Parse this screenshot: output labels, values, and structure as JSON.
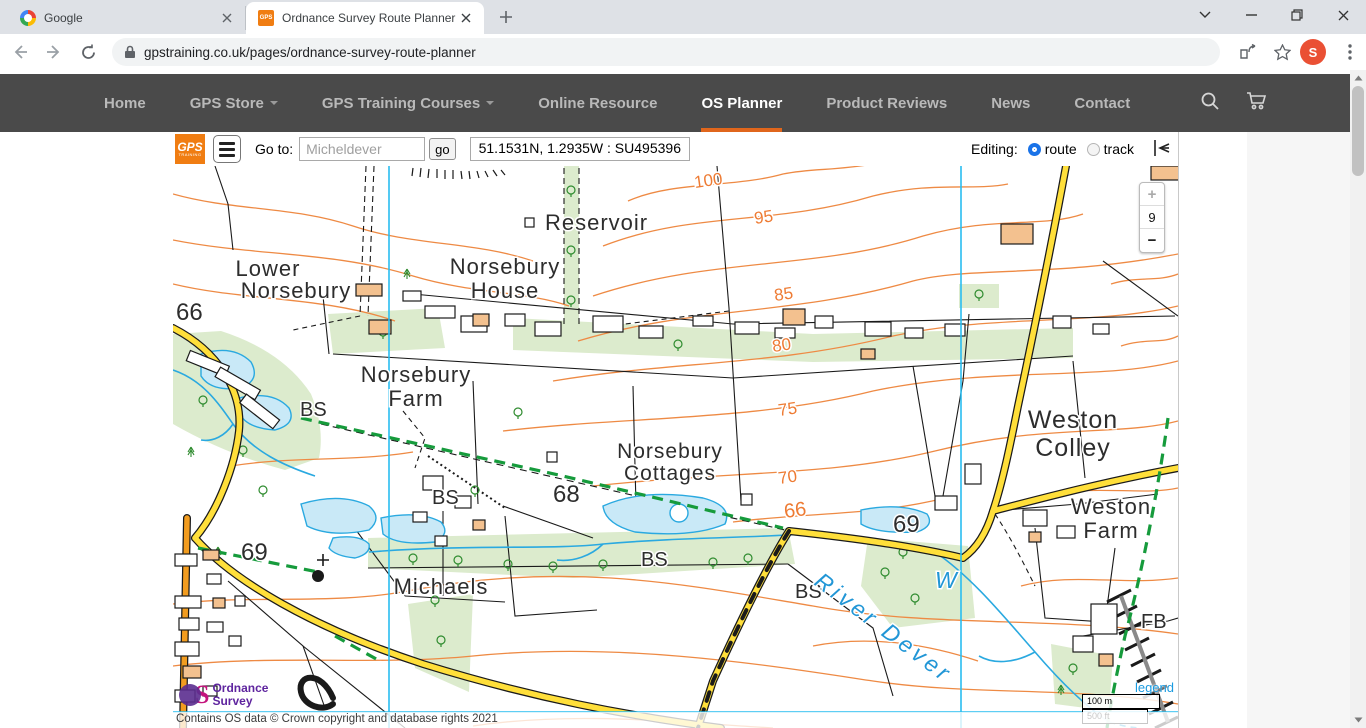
{
  "browser": {
    "tabs": [
      {
        "title": "Google"
      },
      {
        "title": "Ordnance Survey Route Planner –"
      }
    ],
    "favicon_gps": "GPS",
    "url": "gpstraining.co.uk/pages/ordnance-survey-route-planner",
    "avatar": "S"
  },
  "nav": {
    "items": [
      {
        "label": "Home"
      },
      {
        "label": "GPS Store"
      },
      {
        "label": "GPS Training Courses"
      },
      {
        "label": "Online Resource"
      },
      {
        "label": "OS Planner"
      },
      {
        "label": "Product Reviews"
      },
      {
        "label": "News"
      },
      {
        "label": "Contact"
      }
    ],
    "active": "OS Planner"
  },
  "toolbar": {
    "logo_line1": "GPS",
    "logo_line2": "TRAINING",
    "goto_label": "Go to:",
    "search_placeholder": "Micheldever",
    "go_label": "go",
    "coordinates": "51.1531N, 1.2935W : SU495396",
    "editing_label": "Editing:",
    "route_label": "route",
    "track_label": "track"
  },
  "map": {
    "zoom_in": "+",
    "zoom_level": "9",
    "zoom_out": "−",
    "legend_label": "legend",
    "scale_metric": "100 m",
    "scale_imperial": "500 ft",
    "attribution": "Contains OS data © Crown copyright and database rights 2021",
    "os_logo_1": "Ordnance",
    "os_logo_2": "Survey",
    "labels": {
      "reservoir": "Reservoir",
      "lower_norsebury_1": "Lower",
      "lower_norsebury_2": "Norsebury",
      "norsebury_house_1": "Norsebury",
      "norsebury_house_2": "House",
      "norsebury_farm_1": "Norsebury",
      "norsebury_farm_2": "Farm",
      "norsebury_cottages_1": "Norsebury",
      "norsebury_cottages_2": "Cottages",
      "weston_colley_1": "Weston",
      "weston_colley_2": "Colley",
      "weston_farm_1": "Weston",
      "weston_farm_2": "Farm",
      "michaels": "Michaels",
      "river_dever": "River Dever",
      "w": "W",
      "bs": "BS",
      "fb": "FB"
    },
    "contour_labels": {
      "c100": "100",
      "c95": "95",
      "c85": "85",
      "c80": "80",
      "c75": "75",
      "c70": "70",
      "c66": "66"
    },
    "grid_numbers": {
      "g66": "66",
      "g68": "68",
      "g69a": "69",
      "g69b": "69"
    }
  },
  "colors": {
    "nav_bg": "#4a4a4a",
    "nav_accent_orange": "#e0661c",
    "brand_orange": "#f07d12",
    "radio_selected_blue": "#1a73e8",
    "avatar_red": "#ea5034",
    "contour_orange": "#ee8a44",
    "road_yellow": "#ffdf3a",
    "road_orange": "#f29c1f",
    "water_blue": "#2aa9e0",
    "water_fill": "#c9e9f7",
    "woodland_green": "#dcebcd",
    "bridleway_green": "#169b3c",
    "grid_cyan": "#29bdf0",
    "os_purple": "#5f259f"
  }
}
